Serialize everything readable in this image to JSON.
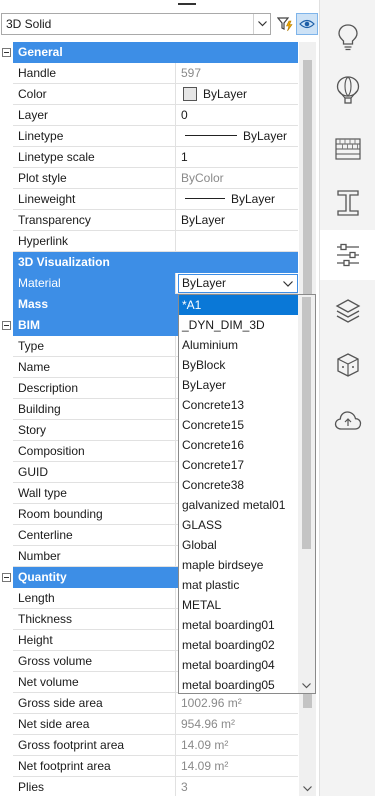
{
  "header": {
    "selector_value": "3D Solid"
  },
  "sections": {
    "general": {
      "title": "General",
      "rows": [
        {
          "name": "Handle",
          "value": "597"
        },
        {
          "name": "Color",
          "value": "ByLayer"
        },
        {
          "name": "Layer",
          "value": "0"
        },
        {
          "name": "Linetype",
          "value": "ByLayer"
        },
        {
          "name": "Linetype scale",
          "value": "1"
        },
        {
          "name": "Plot style",
          "value": "ByColor"
        },
        {
          "name": "Lineweight",
          "value": "ByLayer"
        },
        {
          "name": "Transparency",
          "value": "ByLayer"
        },
        {
          "name": "Hyperlink",
          "value": ""
        }
      ]
    },
    "vis": {
      "title": "3D Visualization",
      "material_name": "Material",
      "material_value": "ByLayer"
    },
    "mass": {
      "title": "Mass"
    },
    "bim": {
      "title": "BIM",
      "rows": [
        {
          "name": "Type"
        },
        {
          "name": "Name"
        },
        {
          "name": "Description"
        },
        {
          "name": "Building"
        },
        {
          "name": "Story"
        },
        {
          "name": "Composition"
        },
        {
          "name": "GUID"
        },
        {
          "name": "Wall type"
        },
        {
          "name": "Room bounding"
        },
        {
          "name": "Centerline"
        },
        {
          "name": "Number"
        }
      ]
    },
    "quantity": {
      "title": "Quantity",
      "rows": [
        {
          "name": "Length",
          "value": ""
        },
        {
          "name": "Thickness",
          "value": ""
        },
        {
          "name": "Height",
          "value": ""
        },
        {
          "name": "Gross volume",
          "value": ""
        },
        {
          "name": "Net volume",
          "value": ""
        },
        {
          "name": "Gross side area",
          "value": "1002.96 m²"
        },
        {
          "name": "Net side area",
          "value": "954.96 m²"
        },
        {
          "name": "Gross footprint area",
          "value": "14.09 m²"
        },
        {
          "name": "Net footprint area",
          "value": "14.09 m²"
        },
        {
          "name": "Plies",
          "value": "3"
        }
      ]
    }
  },
  "dropdown": {
    "items": [
      "*A1",
      "_DYN_DIM_3D",
      "Aluminium",
      "ByBlock",
      "ByLayer",
      "Concrete13",
      "Concrete15",
      "Concrete16",
      "Concrete17",
      "Concrete38",
      "galvanized metal01",
      "GLASS",
      "Global",
      "maple birdseye",
      "mat plastic",
      "METAL",
      "metal boarding01",
      "metal boarding02",
      "metal boarding04",
      "metal boarding05"
    ],
    "highlighted": "*A1"
  },
  "sidebar": {
    "icons": [
      "lightbulb-icon",
      "hot-air-balloon-icon",
      "hatch-pattern-icon",
      "i-beam-icon",
      "sliders-icon",
      "layers-icon",
      "cube-box-icon",
      "cloud-upload-icon"
    ],
    "active": "sliders-icon"
  },
  "colors": {
    "accent": "#3d8ee6",
    "highlight": "#0a78d7"
  }
}
